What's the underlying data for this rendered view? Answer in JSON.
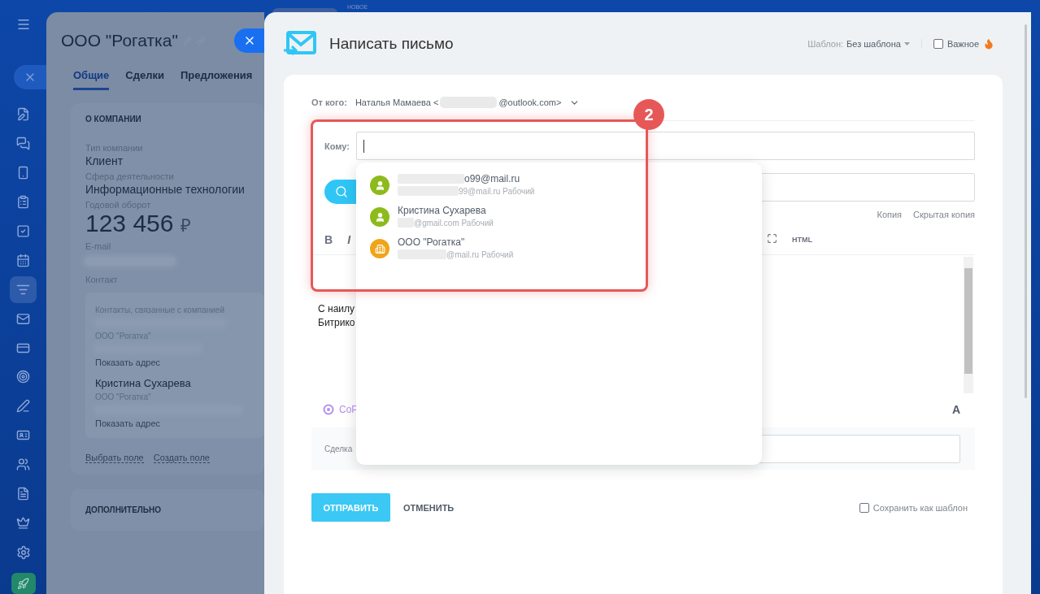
{
  "top_bar": {
    "badge": "НОВОЕ"
  },
  "sidebar": {
    "items": [
      {
        "selected": false
      },
      {
        "selected": false
      },
      {
        "selected": false
      },
      {
        "selected": false
      },
      {
        "selected": false
      },
      {
        "selected": false
      },
      {
        "selected": true
      },
      {
        "selected": false
      },
      {
        "selected": false
      },
      {
        "selected": false
      },
      {
        "selected": false
      },
      {
        "selected": false
      },
      {
        "selected": false
      },
      {
        "selected": false
      },
      {
        "selected": false
      }
    ]
  },
  "company_card": {
    "title": "ООО \"Рогатка\"",
    "tabs": [
      {
        "label": "Общие",
        "selected": true
      },
      {
        "label": "Сделки",
        "selected": false
      },
      {
        "label": "Предложения",
        "selected": false
      }
    ],
    "section_title": "О КОМПАНИИ",
    "fields": [
      {
        "kind": "text",
        "label": "Тип компании",
        "value": "Клиент"
      },
      {
        "kind": "text",
        "label": "Сфера деятельности",
        "value": "Информационные технологии"
      },
      {
        "kind": "amount",
        "label": "Годовой оборот",
        "value": "123 456",
        "currency": "₽"
      },
      {
        "kind": "redacted",
        "label": "E-mail"
      }
    ],
    "contact": {
      "label": "Контакт",
      "related_label": "Контакты, связанные с компанией",
      "entries": [
        {
          "company": "ООО \"Рогатка\"",
          "link": "Показать адрес"
        },
        {
          "name": "Кристина Сухарева",
          "company": "ООО \"Рогатка\"",
          "link": "Показать адрес"
        }
      ]
    },
    "footer_links": [
      "Выбрать поле",
      "Создать поле"
    ],
    "extra_section": "ДОПОЛНИТЕЛЬНО"
  },
  "email_form": {
    "title": "Написать письмо",
    "template_label": "Шаблон:",
    "template_value": "Без шаблона",
    "important": {
      "label": "Важное",
      "checked": false
    },
    "from_label": "От кого:",
    "from_name": "Наталья Мамаева <",
    "from_domain": "@outlook.com>",
    "to_label": "Кому:",
    "copy_links": [
      "Копия",
      "Скрытая копия"
    ],
    "toolbar": [
      "B",
      "I"
    ],
    "html_label": "HTML",
    "body_lines": [
      "С наилу",
      "Битрико"
    ],
    "copilot_label": "CoP",
    "font_button": "A",
    "deal_label": "Сделка",
    "send": "ОТПРАВИТЬ",
    "cancel": "ОТМЕНИТЬ",
    "save_template": {
      "label": "Сохранить как шаблон",
      "checked": false
    }
  },
  "suggestions": [
    {
      "kind": "contact",
      "title": "o99@mail.ru",
      "title_redacted": true,
      "subtitle": "99@mail.ru Рабочий"
    },
    {
      "kind": "contact",
      "title": "Кристина Сухарева",
      "title_redacted": false,
      "subtitle": "@gmail.com Рабочий"
    },
    {
      "kind": "company",
      "title": "ООО \"Рогатка\"",
      "title_redacted": false,
      "subtitle": "@mail.ru Рабочий"
    }
  ],
  "annotation": {
    "number": "2"
  }
}
